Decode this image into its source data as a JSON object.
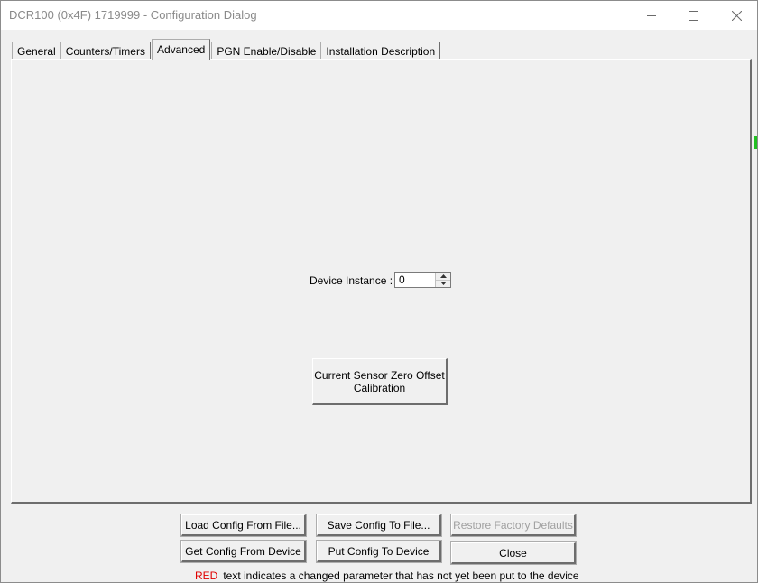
{
  "window": {
    "title": "DCR100 (0x4F) 1719999 - Configuration Dialog",
    "controls": {
      "minimize": "minimize-icon",
      "maximize": "maximize-icon",
      "close": "close-icon"
    }
  },
  "tabs": [
    {
      "label": "General",
      "active": false
    },
    {
      "label": "Counters/Timers",
      "active": false
    },
    {
      "label": "Advanced",
      "active": true
    },
    {
      "label": "PGN Enable/Disable",
      "active": false
    },
    {
      "label": "Installation Description",
      "active": false
    }
  ],
  "advanced": {
    "device_instance_label": "Device Instance :",
    "device_instance_value": "0",
    "calibration_button_line1": "Current Sensor Zero Offset",
    "calibration_button_line2": "Calibration"
  },
  "buttons": {
    "load_config": "Load Config From File...",
    "save_config": "Save Config To File...",
    "restore_defaults": "Restore Factory Defaults",
    "get_config": "Get Config From Device",
    "put_config": "Put Config To Device",
    "close": "Close"
  },
  "footer": {
    "red_word": "RED",
    "note_text": "text indicates a changed parameter that has not yet been put to the device"
  },
  "colors": {
    "red_text": "#e00000",
    "window_bg": "#f0f0f0",
    "title_text": "#8a8a8a"
  }
}
